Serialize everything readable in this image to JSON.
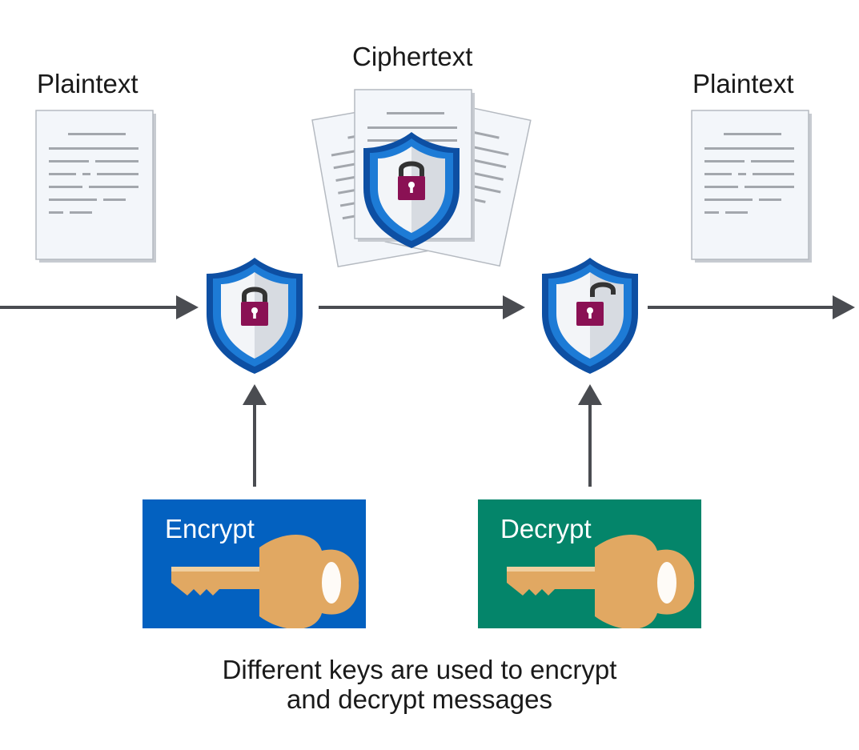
{
  "labels": {
    "plaintext_left": "Plaintext",
    "ciphertext": "Ciphertext",
    "plaintext_right": "Plaintext"
  },
  "keys": {
    "encrypt": {
      "label": "Encrypt",
      "color": "#0361c0"
    },
    "decrypt": {
      "label": "Decrypt",
      "color": "#04856a"
    }
  },
  "caption": {
    "line1": "Different keys are used to encrypt",
    "line2": "and decrypt messages"
  },
  "colors": {
    "arrow": "#4a4c51",
    "shield_outer": "#0d4fa3",
    "shield_inner": "#1d7bd6",
    "lock": "#8a1154",
    "key": "#e1a862"
  },
  "icons": [
    "document-icon",
    "shield-lock-icon",
    "shield-unlock-icon",
    "key-icon",
    "arrow-right-icon",
    "arrow-up-icon"
  ]
}
